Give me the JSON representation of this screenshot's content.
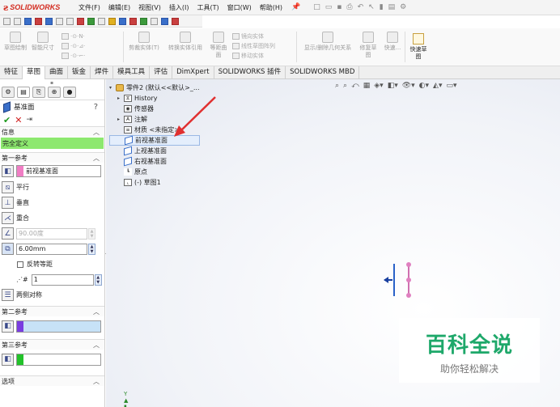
{
  "app": {
    "brand_ds": "ƨ",
    "brand_name": "SOLIDWORKS",
    "menu": [
      "文件(F)",
      "编辑(E)",
      "视图(V)",
      "插入(I)",
      "工具(T)",
      "窗口(W)",
      "帮助(H)"
    ]
  },
  "ribbon": {
    "sketch_draw": "草图绘制",
    "smart_dim": "智能尺寸",
    "cut_entity": "剪裁实体(T)",
    "convert_entity": "转换实体引用",
    "offset_curve": "等距曲面",
    "mirror": "镜向实体",
    "linear_pattern": "线性草图阵列",
    "move_entity": "移动实体",
    "show_relations": "显示/删除几何关系",
    "repair": "修复草图",
    "quick_snap": "快速...",
    "quick_sketch": "快速草图"
  },
  "tabs": [
    "特征",
    "草图",
    "曲面",
    "钣金",
    "焊件",
    "模具工具",
    "评估",
    "DimXpert",
    "SOLIDWORKS 插件",
    "SOLIDWORKS MBD"
  ],
  "active_tab": "草图",
  "panel": {
    "title": "基准面",
    "help": "?",
    "ok": "✔",
    "cancel": "✕",
    "pin": "⇥",
    "info_label": "信息",
    "status": "完全定义",
    "first_ref_label": "第一参考",
    "first_ref_value": "前视基准面",
    "first_ref_color": "#f07ec4",
    "parallel": "平行",
    "perpendicular": "垂直",
    "coincident": "重合",
    "angle_value": "90.00度",
    "distance_value": "6.00mm",
    "flip_offset": "反转等距",
    "count_value": "1",
    "mid_plane": "两侧对称",
    "second_ref_label": "第二参考",
    "second_ref_color": "#7a3de0",
    "third_ref_label": "第三参考",
    "third_ref_color": "#22c22a",
    "options_label": "选项"
  },
  "tree": {
    "root": "零件2 (默认<<默认>_...",
    "items": [
      "History",
      "传感器",
      "注解",
      "材质 <未指定>",
      "前视基准面",
      "上视基准面",
      "右视基准面",
      "原点",
      "(-) 草图1"
    ]
  },
  "watermark": {
    "title": "百科全说",
    "subtitle": "助你轻松解决"
  },
  "colors": {
    "status_green": "#8de86f",
    "arrow_red": "#e03030",
    "plane_blue": "#2a62c8"
  }
}
